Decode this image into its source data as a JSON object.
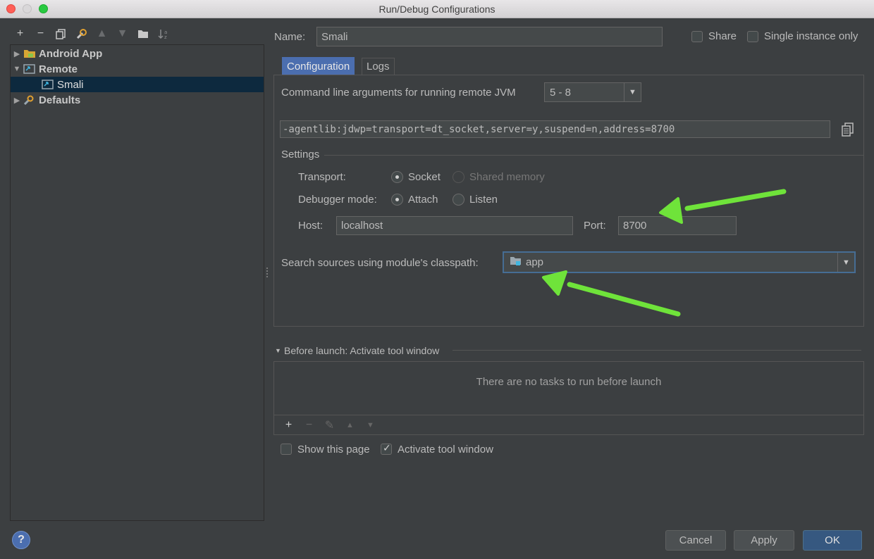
{
  "window": {
    "title": "Run/Debug Configurations"
  },
  "toolbar": {
    "icons": [
      "plus-icon",
      "minus-icon",
      "copy-icon",
      "wrench-icon",
      "arrow-up-icon",
      "arrow-down-icon",
      "folder-icon",
      "sort-icon"
    ]
  },
  "tree": {
    "items": [
      {
        "label": "Android App",
        "expanded": false
      },
      {
        "label": "Remote",
        "expanded": true
      },
      {
        "label": "Smali",
        "selected": true
      },
      {
        "label": "Defaults",
        "expanded": false
      }
    ]
  },
  "header": {
    "name_label": "Name:",
    "name_value": "Smali",
    "share_label": "Share",
    "single_instance_label": "Single instance only"
  },
  "tabs": [
    {
      "label": "Configuration",
      "active": true
    },
    {
      "label": "Logs",
      "active": false
    }
  ],
  "config": {
    "cmdline_label": "Command line arguments for running remote JVM",
    "jvm_version": "5 - 8",
    "agent_args": "-agentlib:jdwp=transport=dt_socket,server=y,suspend=n,address=8700",
    "settings_label": "Settings",
    "transport_label": "Transport:",
    "socket_label": "Socket",
    "shared_memory_label": "Shared memory",
    "debugger_mode_label": "Debugger mode:",
    "attach_label": "Attach",
    "listen_label": "Listen",
    "host_label": "Host:",
    "host_value": "localhost",
    "port_label": "Port:",
    "port_value": "8700",
    "classpath_label": "Search sources using module's classpath:",
    "classpath_value": "app"
  },
  "before_launch": {
    "title": "Before launch: Activate tool window",
    "empty_text": "There are no tasks to run before launch"
  },
  "footer": {
    "show_page_label": "Show this page",
    "activate_tool_label": "Activate tool window",
    "cancel_label": "Cancel",
    "apply_label": "Apply",
    "ok_label": "OK",
    "help_label": "?"
  },
  "colors": {
    "accent": "#4b6eaf",
    "annotation_arrow": "#6fe33a",
    "selection": "#0d293e"
  }
}
